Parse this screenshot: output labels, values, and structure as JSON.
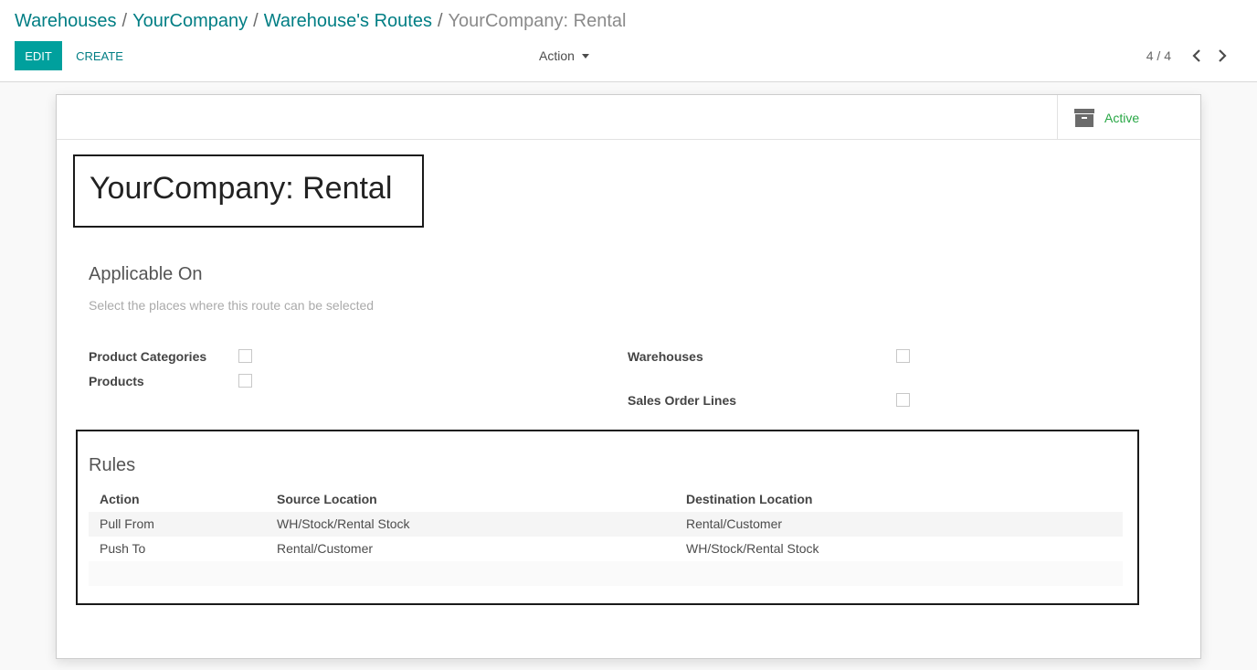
{
  "breadcrumb": {
    "items": [
      "Warehouses",
      "YourCompany",
      "Warehouse's Routes"
    ],
    "separator": "/",
    "current": "YourCompany: Rental"
  },
  "toolbar": {
    "edit_label": "EDIT",
    "create_label": "CREATE",
    "action_label": "Action"
  },
  "pager": {
    "value": "4 / 4"
  },
  "stat_button": {
    "label": "Active",
    "icon": "archive-icon"
  },
  "record": {
    "title": "YourCompany: Rental"
  },
  "applicable_on": {
    "title": "Applicable On",
    "help": "Select the places where this route can be selected",
    "fields": {
      "product_categories": "Product Categories",
      "products": "Products",
      "warehouses": "Warehouses",
      "sales_order_lines": "Sales Order Lines"
    }
  },
  "rules": {
    "title": "Rules",
    "columns": [
      "Action",
      "Source Location",
      "Destination Location"
    ],
    "rows": [
      [
        "Pull From",
        "WH/Stock/Rental Stock",
        "Rental/Customer"
      ],
      [
        "Push To",
        "Rental/Customer",
        "WH/Stock/Rental Stock"
      ]
    ]
  },
  "colors": {
    "primary": "#00a09d",
    "link": "#017e84",
    "active": "#28a745"
  }
}
